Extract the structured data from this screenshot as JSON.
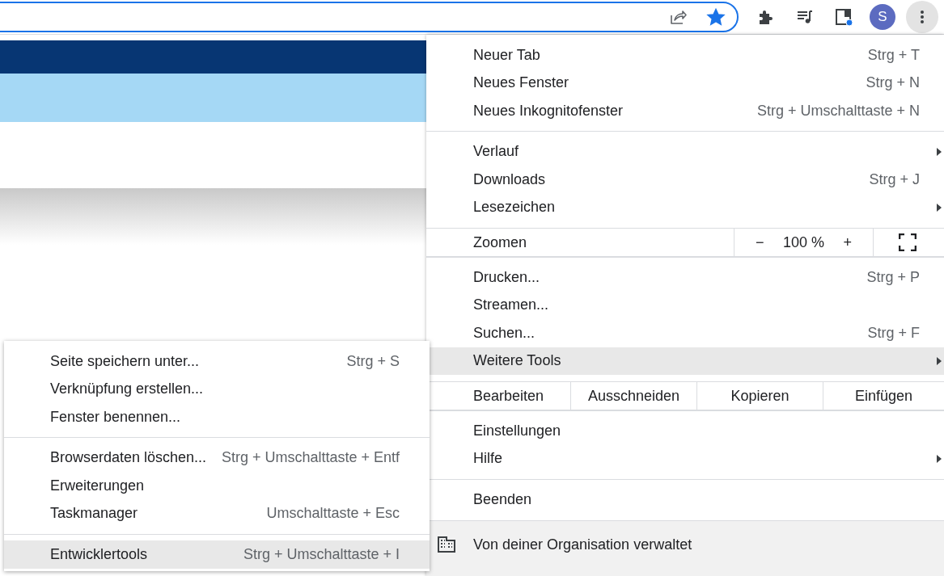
{
  "toolbar": {
    "omnibox_focused": true,
    "bookmarked": true,
    "avatar_letter": "S",
    "menu_open": true
  },
  "menu": {
    "items": [
      {
        "kind": "item",
        "label": "Neuer Tab",
        "shortcut": "Strg + T",
        "submenu": false,
        "selected": false
      },
      {
        "kind": "item",
        "label": "Neues Fenster",
        "shortcut": "Strg + N",
        "submenu": false,
        "selected": false
      },
      {
        "kind": "item",
        "label": "Neues Inkognitofenster",
        "shortcut": "Strg + Umschalttaste + N",
        "submenu": false,
        "selected": false
      },
      {
        "kind": "separator"
      },
      {
        "kind": "item",
        "label": "Verlauf",
        "submenu": true,
        "selected": false
      },
      {
        "kind": "item",
        "label": "Downloads",
        "shortcut": "Strg + J",
        "submenu": false,
        "selected": false
      },
      {
        "kind": "item",
        "label": "Lesezeichen",
        "submenu": true,
        "selected": false
      },
      {
        "kind": "separator"
      },
      {
        "kind": "zoom",
        "label": "Zoomen",
        "minus": "−",
        "value": "100 %",
        "plus": "+"
      },
      {
        "kind": "separator"
      },
      {
        "kind": "item",
        "label": "Drucken...",
        "shortcut": "Strg + P",
        "submenu": false,
        "selected": false
      },
      {
        "kind": "item",
        "label": "Streamen...",
        "submenu": false,
        "selected": false
      },
      {
        "kind": "item",
        "label": "Suchen...",
        "shortcut": "Strg + F",
        "submenu": false,
        "selected": false
      },
      {
        "kind": "item",
        "label": "Weitere Tools",
        "submenu": true,
        "selected": true
      },
      {
        "kind": "separator"
      },
      {
        "kind": "edit",
        "label": "Bearbeiten",
        "buttons": [
          "Ausschneiden",
          "Kopieren",
          "Einfügen"
        ]
      },
      {
        "kind": "separator"
      },
      {
        "kind": "item",
        "label": "Einstellungen",
        "submenu": false,
        "selected": false
      },
      {
        "kind": "item",
        "label": "Hilfe",
        "submenu": true,
        "selected": false
      },
      {
        "kind": "separator"
      },
      {
        "kind": "item",
        "label": "Beenden",
        "submenu": false,
        "selected": false
      },
      {
        "kind": "managed",
        "label": "Von deiner Organisation verwaltet"
      }
    ]
  },
  "submenu": {
    "items": [
      {
        "kind": "item",
        "label": "Seite speichern unter...",
        "shortcut": "Strg + S",
        "selected": false
      },
      {
        "kind": "item",
        "label": "Verknüpfung erstellen...",
        "selected": false
      },
      {
        "kind": "item",
        "label": "Fenster benennen...",
        "selected": false
      },
      {
        "kind": "separator"
      },
      {
        "kind": "item",
        "label": "Browserdaten löschen...",
        "shortcut": "Strg + Umschalttaste + Entf",
        "selected": false
      },
      {
        "kind": "item",
        "label": "Erweiterungen",
        "selected": false
      },
      {
        "kind": "item",
        "label": "Taskmanager",
        "shortcut": "Umschalttaste + Esc",
        "selected": false
      },
      {
        "kind": "separator"
      },
      {
        "kind": "item",
        "label": "Entwicklertools",
        "shortcut": "Strg + Umschalttaste + I",
        "selected": true
      }
    ]
  }
}
